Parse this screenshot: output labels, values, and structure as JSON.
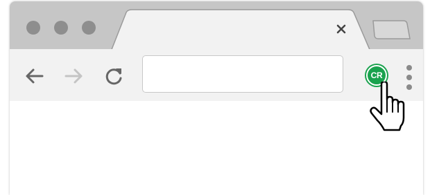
{
  "window": {
    "traffic_lights": [
      "close",
      "minimize",
      "zoom"
    ]
  },
  "tab": {
    "title": "",
    "close_icon": "close-icon"
  },
  "new_tab": {
    "icon": "new-tab-icon"
  },
  "toolbar": {
    "back_icon": "arrow-left-icon",
    "forward_icon": "arrow-right-icon",
    "reload_icon": "reload-icon",
    "forward_enabled": false
  },
  "omnibox": {
    "value": "",
    "placeholder": ""
  },
  "extension": {
    "label": "CR",
    "color": "#1aa24e"
  },
  "menu": {
    "icon": "kebab-menu-icon"
  },
  "pointer": {
    "icon": "hand-pointer-icon"
  },
  "colors": {
    "titlebar": "#c6c6c6",
    "tab": "#f2f2f2",
    "toolbar": "#f2f2f2",
    "icon": "#666666",
    "icon_disabled": "#c4c4c4"
  }
}
